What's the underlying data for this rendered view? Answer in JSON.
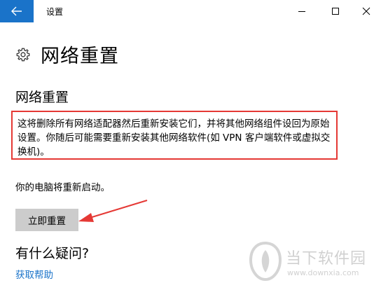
{
  "window": {
    "title": "设置"
  },
  "page": {
    "title": "网络重置"
  },
  "section": {
    "title": "网络重置",
    "warning_text": "这将删除所有网络适配器然后重新安装它们，并将其他网络组件设回为原始设置。你随后可能需要重新安装其他网络软件(如 VPN 客户端软件或虚拟交换机)。",
    "restart_text": "你的电脑将重新启动。",
    "reset_button_label": "立即重置"
  },
  "help": {
    "title": "有什么疑问?",
    "link_label": "获取帮助"
  },
  "watermark": {
    "name": "当下软件园",
    "url": "www.downxia.com"
  },
  "colors": {
    "accent": "#1a73c9",
    "highlight_border": "#e53935",
    "button_bg": "#cccccc"
  },
  "icons": {
    "back": "arrow-left-icon",
    "minimize": "minimize-icon",
    "maximize": "maximize-icon",
    "close": "close-icon",
    "page": "gear-icon"
  }
}
